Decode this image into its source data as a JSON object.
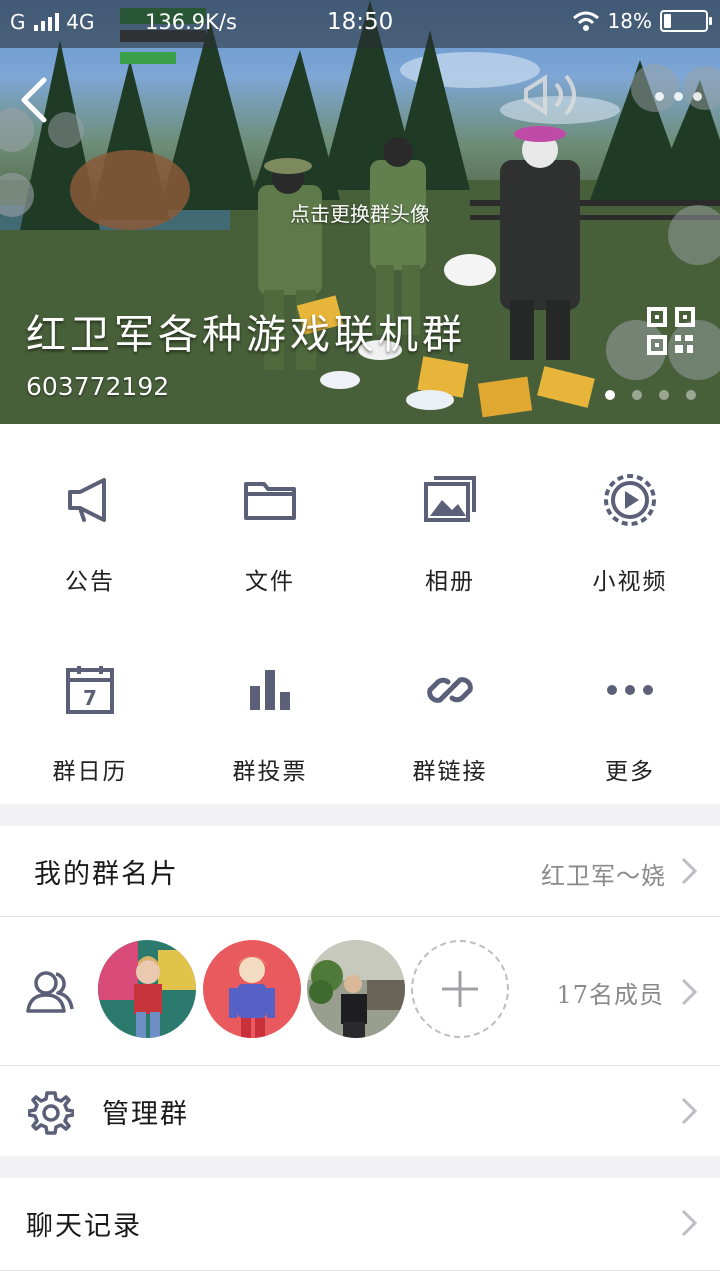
{
  "status_bar": {
    "carrier": "G",
    "network": "4G",
    "speed": "136.9K/s",
    "time": "18:50",
    "battery_text": "18%",
    "battery_level": 0.18
  },
  "banner": {
    "avatar_hint": "点击更换群头像",
    "group_name": "红卫军各种游戏联机群",
    "group_id": "603772192",
    "carousel_pages": 4,
    "carousel_active": 0
  },
  "features": [
    {
      "label": "公告",
      "icon": "megaphone-icon"
    },
    {
      "label": "文件",
      "icon": "folder-icon"
    },
    {
      "label": "相册",
      "icon": "photo-album-icon"
    },
    {
      "label": "小视频",
      "icon": "video-icon"
    },
    {
      "label": "群日历",
      "icon": "calendar-icon"
    },
    {
      "label": "群投票",
      "icon": "bar-chart-icon"
    },
    {
      "label": "群链接",
      "icon": "link-icon"
    },
    {
      "label": "更多",
      "icon": "more-icon"
    }
  ],
  "calendar_day": "7",
  "card": {
    "label": "我的群名片",
    "value": "红卫军～娆"
  },
  "members": {
    "count_text": "17名成员"
  },
  "manage": {
    "label": "管理群"
  },
  "chat_history": {
    "label": "聊天记录"
  },
  "colors": {
    "icon": "#5b5f78",
    "text": "#1a1a1a",
    "muted": "#8a8a8a",
    "chevron": "#bdbdc2"
  }
}
